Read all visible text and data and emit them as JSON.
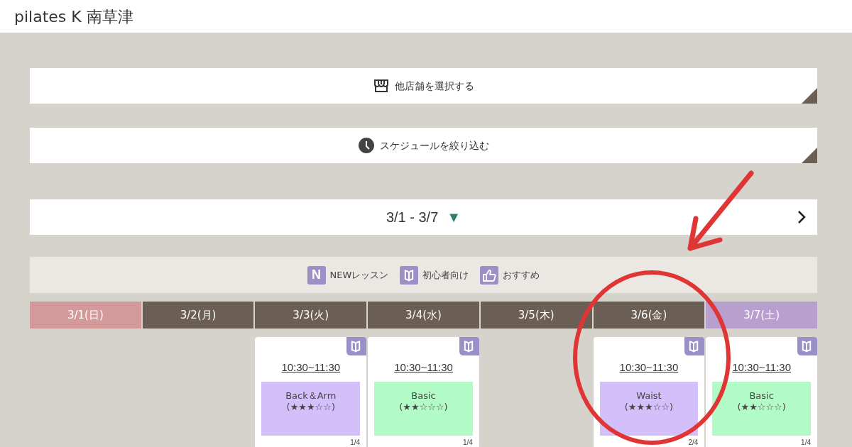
{
  "header": {
    "title": "pilates K 南草津"
  },
  "store_select": {
    "label": "他店舗を選択する"
  },
  "schedule_filter": {
    "label": "スケジュールを絞り込む"
  },
  "week_nav": {
    "range": "3/1 - 3/7",
    "toggle": "▼"
  },
  "legend": [
    {
      "kind": "new",
      "icon_text": "N",
      "label": "NEWレッスン"
    },
    {
      "kind": "beginner",
      "label": "初心者向け"
    },
    {
      "kind": "recommended",
      "label": "おすすめ"
    }
  ],
  "days": [
    {
      "label": "3/1(日)",
      "kind": "sunday"
    },
    {
      "label": "3/2(月)",
      "kind": "weekday"
    },
    {
      "label": "3/3(火)",
      "kind": "weekday",
      "lessons": [
        {
          "time": "10:30~11:30",
          "name": "Back＆Arm",
          "difficulty": "(★★★☆☆)",
          "color": "#d3c0fb",
          "capacity": "1/4"
        }
      ]
    },
    {
      "label": "3/4(水)",
      "kind": "weekday",
      "lessons": [
        {
          "time": "10:30~11:30",
          "name": "Basic",
          "difficulty": "(★★☆☆☆)",
          "color": "#b3fbc6",
          "capacity": "1/4"
        }
      ]
    },
    {
      "label": "3/5(木)",
      "kind": "weekday"
    },
    {
      "label": "3/6(金)",
      "kind": "weekday",
      "lessons": [
        {
          "time": "10:30~11:30",
          "name": "Waist",
          "difficulty": "(★★★☆☆)",
          "color": "#d3c0fb",
          "capacity": "2/4"
        }
      ]
    },
    {
      "label": "3/7(土)",
      "kind": "saturday",
      "lessons": [
        {
          "time": "10:30~11:30",
          "name": "Basic",
          "difficulty": "(★★☆☆☆)",
          "color": "#b3fbc6",
          "capacity": "1/4"
        }
      ]
    }
  ]
}
